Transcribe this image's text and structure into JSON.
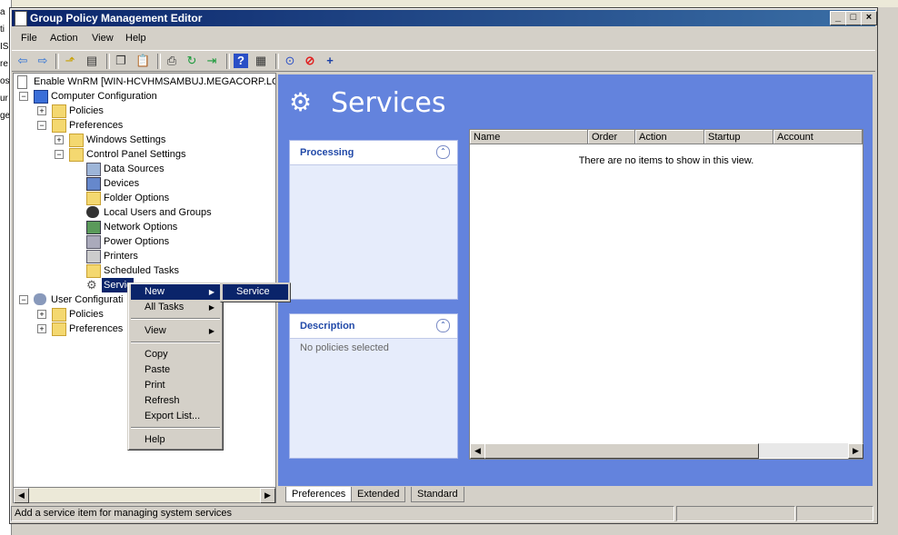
{
  "window": {
    "title": "Group Policy Management Editor"
  },
  "menubar": [
    "File",
    "Action",
    "View",
    "Help"
  ],
  "toolbar": [
    "back-icon",
    "forward-icon",
    "up-icon",
    "show-hide-tree-icon",
    "copy-icon",
    "paste-icon",
    "print-icon",
    "refresh-icon",
    "export-icon",
    "help-icon",
    "properties-icon",
    "reset-icon",
    "stop-icon",
    "add-icon"
  ],
  "tree": {
    "root": "Enable WnRM [WIN-HCVHMSAMBUJ.MEGACORP.LOCA",
    "computer_config": "Computer Configuration",
    "policies": "Policies",
    "preferences": "Preferences",
    "windows_settings": "Windows Settings",
    "control_panel_settings": "Control Panel Settings",
    "data_sources": "Data Sources",
    "devices": "Devices",
    "folder_options": "Folder Options",
    "local_users_groups": "Local Users and Groups",
    "network_options": "Network Options",
    "power_options": "Power Options",
    "printers": "Printers",
    "scheduled_tasks": "Scheduled Tasks",
    "services": "Servic",
    "user_config": "User Configurati",
    "user_policies": "Policies",
    "user_preferences": "Preferences"
  },
  "right": {
    "title": "Services",
    "processing": "Processing",
    "description": "Description",
    "description_text": "No policies selected",
    "columns": [
      "Name",
      "Order",
      "Action",
      "Startup",
      "Account"
    ],
    "empty_message": "There are no items to show in this view."
  },
  "tabs": [
    "Preferences",
    "Extended",
    "Standard"
  ],
  "status": {
    "text": "Add a service item for managing system services"
  },
  "context_menu": {
    "new": "New",
    "all_tasks": "All Tasks",
    "view": "View",
    "copy": "Copy",
    "paste": "Paste",
    "print": "Print",
    "refresh": "Refresh",
    "export": "Export List...",
    "help": "Help"
  },
  "submenu": {
    "service": "Service"
  },
  "background": [
    "a",
    "ti",
    "IS",
    "re",
    "os",
    "ur",
    "ge"
  ]
}
